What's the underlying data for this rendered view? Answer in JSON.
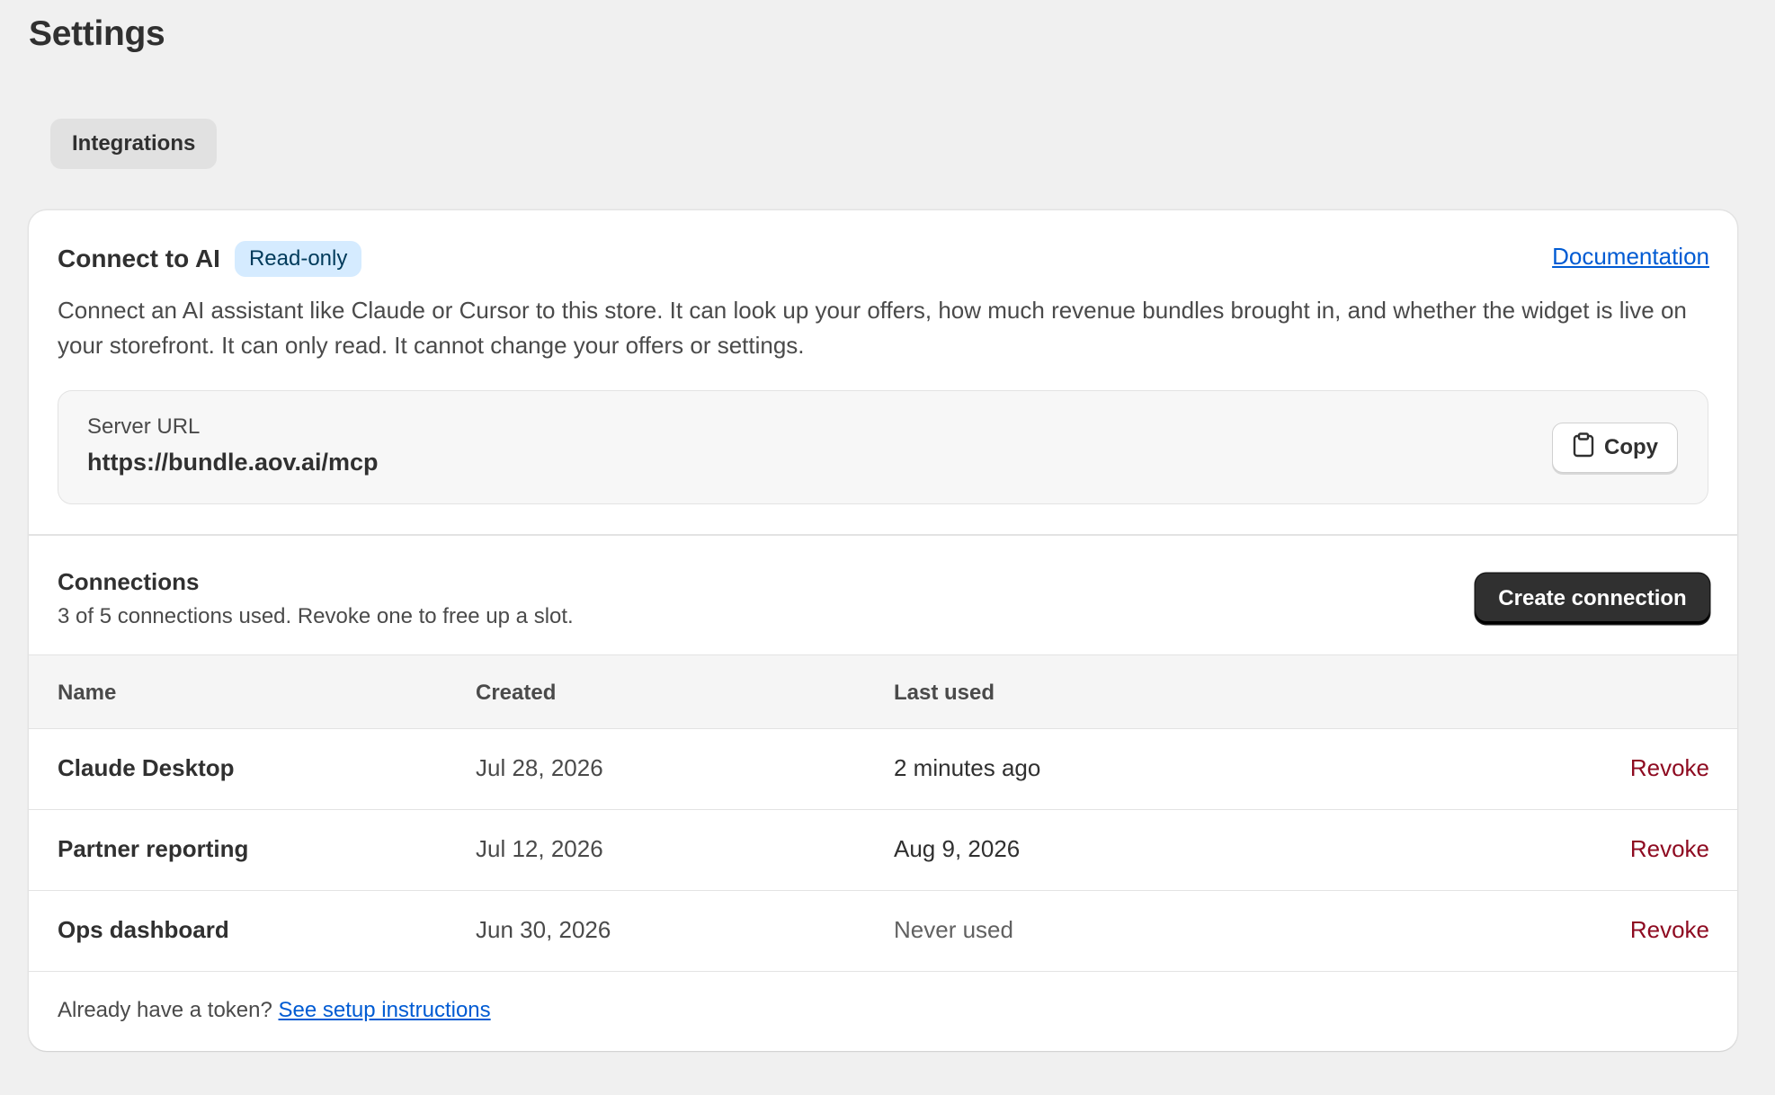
{
  "page": {
    "title": "Settings"
  },
  "tabs": [
    {
      "label": "Integrations"
    }
  ],
  "ai_section": {
    "title": "Connect to AI",
    "badge": "Read-only",
    "doc_link": "Documentation",
    "description": "Connect an AI assistant like Claude or Cursor to this store. It can look up your offers, how much revenue bundles brought in, and whether the widget is live on your storefront. It can only read. It cannot change your offers or settings.",
    "server": {
      "label": "Server URL",
      "url": "https://bundle.aov.ai/mcp",
      "copy_label": "Copy",
      "copy_icon": "clipboard-icon"
    }
  },
  "connections": {
    "title": "Connections",
    "subtitle": "3 of 5 connections used. Revoke one to free up a slot.",
    "create_label": "Create connection",
    "columns": [
      "Name",
      "Created",
      "Last used"
    ],
    "rows": [
      {
        "name": "Claude Desktop",
        "created": "Jul 28, 2026",
        "last_used": "2 minutes ago",
        "action": "Revoke"
      },
      {
        "name": "Partner reporting",
        "created": "Jul 12, 2026",
        "last_used": "Aug 9, 2026",
        "action": "Revoke"
      },
      {
        "name": "Ops dashboard",
        "created": "Jun 30, 2026",
        "last_used": "Never used",
        "action": "Revoke"
      }
    ]
  },
  "footer": {
    "text": "Already have a token?",
    "link": "See setup instructions"
  },
  "colors": {
    "background": "#f0f0f0",
    "badge_bg": "#d5ebff",
    "link": "#005bd3",
    "revoke": "#8e0b21",
    "primary_button": "#303030"
  }
}
